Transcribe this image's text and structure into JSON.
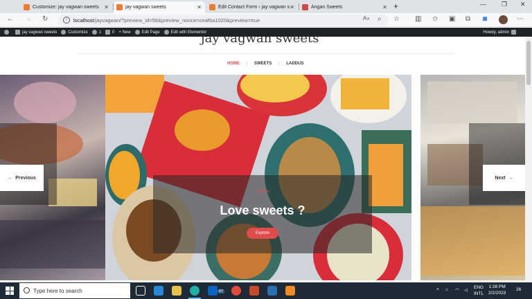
{
  "browser": {
    "tabs": [
      {
        "title": "Customize: jay vagwan sweets",
        "active": false
      },
      {
        "title": "jay vagwan sweets",
        "active": true
      },
      {
        "title": "Edit Contact Form ‹ jay vagwan s",
        "active": false
      },
      {
        "title": "Angan Sweets",
        "active": false
      }
    ],
    "url_host": "localhost",
    "url_path": "/jayvagwan/?preview_id=58&preview_nonce=ceaf6a1020&preview=true"
  },
  "adminbar": {
    "site": "jay vagwan sweets",
    "customize": "Customize",
    "updates_count": "1",
    "comments_count": "0",
    "new": "+ New",
    "edit_page": "Edit Page",
    "edit_elementor": "Edit with Elementor",
    "howdy": "Howdy, admin"
  },
  "site": {
    "title": "jay vagwan sweets",
    "nav": [
      "HOME",
      "SWEETS",
      "LADDUS"
    ]
  },
  "slider": {
    "caption_small": "Sweets",
    "caption_title": "Love sweets ?",
    "cta": "Explore",
    "prev": "Previous",
    "next": "Next"
  },
  "taskbar": {
    "search_placeholder": "Type here to search",
    "lang_top": "ENG",
    "lang_bottom": "INTL",
    "time": "1:28 PM",
    "date": "2/2/2023",
    "notification_count": "26",
    "mail_badge": "67"
  },
  "colors": {
    "accent": "#e04b4b",
    "adminbar": "#1d2327",
    "taskbar": "#1f2a37"
  }
}
